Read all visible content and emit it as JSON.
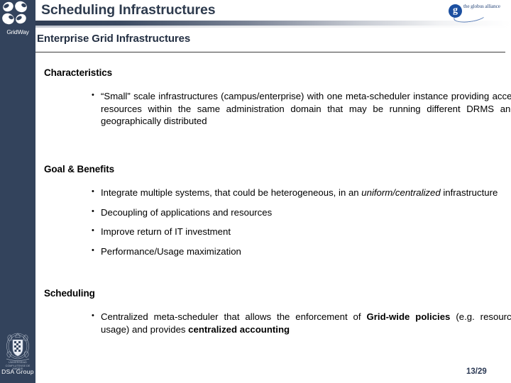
{
  "brand": {
    "rail_logo_name": "gridway-logo",
    "rail_logo_text": "GridWay",
    "rail_color": "#33435c",
    "footer_logo_name": "ucm-crest",
    "footer_university_line": "UNIVERSIDAD COMPLUTENSE DE MADRID",
    "footer_group_text": "DSA Group"
  },
  "partner_logo": {
    "name": "globus-alliance-logo",
    "mark_letter": "g",
    "text": "the globus alliance",
    "color": "#1b4fa0"
  },
  "header": {
    "title": "Scheduling Infrastructures",
    "subtitle": "Enterprise Grid Infrastructures"
  },
  "sections": [
    {
      "heading": "Characteristics",
      "bullets": [
        {
          "parts": [
            {
              "text": "“Small” scale infrastructures (campus/enterprise) with one meta-scheduler instance providing  access to resources within the same administration domain that may be running different DRMS and be geographically distributed",
              "style": "normal"
            }
          ]
        }
      ]
    },
    {
      "heading": "Goal & Benefits",
      "bullets": [
        {
          "parts": [
            {
              "text": "Integrate multiple systems, that could be heterogeneous, in an ",
              "style": "normal"
            },
            {
              "text": "uniform/centralized",
              "style": "italic"
            },
            {
              "text": " infrastructure",
              "style": "normal"
            }
          ]
        },
        {
          "parts": [
            {
              "text": "Decoupling of applications and resources",
              "style": "normal"
            }
          ]
        },
        {
          "parts": [
            {
              "text": "Improve return of IT investment",
              "style": "normal"
            }
          ]
        },
        {
          "parts": [
            {
              "text": "Performance/Usage maximization",
              "style": "normal"
            }
          ]
        }
      ]
    },
    {
      "heading": "Scheduling",
      "bullets": [
        {
          "parts": [
            {
              "text": "Centralized meta-scheduler that allows the enforcement of ",
              "style": "normal"
            },
            {
              "text": "Grid-wide policies",
              "style": "bold"
            },
            {
              "text": " (e.g. resource usage) and provides ",
              "style": "normal"
            },
            {
              "text": "centralized accounting",
              "style": "bold"
            }
          ]
        }
      ]
    }
  ],
  "footer": {
    "page_number": "13/29"
  }
}
